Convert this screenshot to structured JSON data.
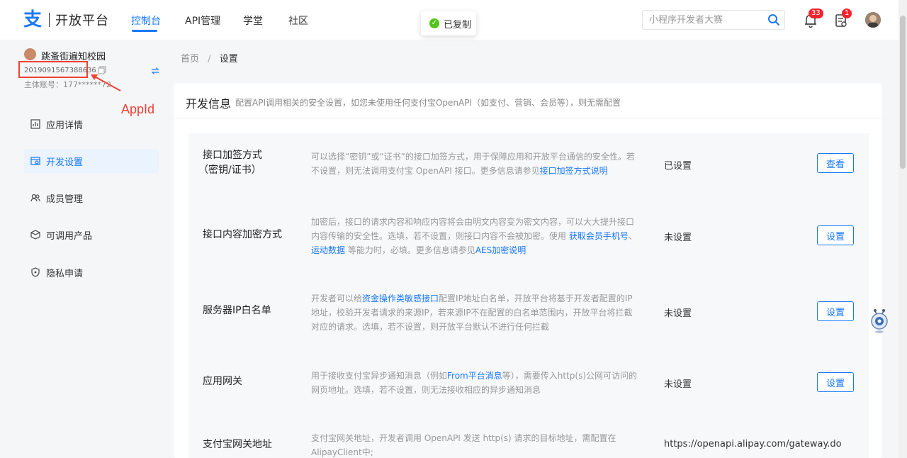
{
  "header": {
    "logo_mark": "支",
    "logo_text": "开放平台",
    "nav": [
      {
        "label": "控制台",
        "active": true
      },
      {
        "label": "API管理",
        "active": false
      },
      {
        "label": "学堂",
        "active": false
      },
      {
        "label": "社区",
        "active": false
      }
    ],
    "search_placeholder": "小程序开发者大赛",
    "notifications_badge": "33",
    "docs_badge": "1"
  },
  "toast": {
    "text": "已复制"
  },
  "sidebar": {
    "app_name": "跳蚤街遍知校园",
    "app_id": "2019091567388636",
    "owner_label": "主体账号：177******72",
    "annotation_label": "AppId",
    "menu": [
      {
        "label": "应用详情",
        "icon": "chart-icon",
        "active": false
      },
      {
        "label": "开发设置",
        "icon": "settings-icon",
        "active": true
      },
      {
        "label": "成员管理",
        "icon": "members-icon",
        "active": false
      },
      {
        "label": "可调用产品",
        "icon": "products-icon",
        "active": false
      },
      {
        "label": "隐私申请",
        "icon": "privacy-icon",
        "active": false
      }
    ]
  },
  "breadcrumb": {
    "home": "首页",
    "separator": "/",
    "current": "设置"
  },
  "card": {
    "title": "开发信息",
    "subtitle": "配置API调用相关的安全设置，如您未使用任何支付宝OpenAPI（如支付、营销、会员等），则无需配置"
  },
  "rows": [
    {
      "title_line1": "接口加签方式",
      "title_line2": "（密钥/证书）",
      "desc_pre": "可以选择“密钥”或“证书”的接口加签方式，用于保障应用和开放平台通信的安全性。若不设置，则无法调用支付宝 OpenAPI 接口。更多信息请参见",
      "desc_link": "接口加签方式说明",
      "status": "已设置",
      "button": "查看"
    },
    {
      "title_line1": "接口内容加密方式",
      "desc_pre": "加密后，接口的请求内容和响应内容将会由明文内容变为密文内容，可以大大提升接口内容传输的安全性。选填，若不设置，则接口内容不会被加密。使用 ",
      "desc_link1": "获取会员手机号",
      "desc_mid1": "、",
      "desc_link2": "运动数据",
      "desc_mid2": " 等能力时，必填。更多信息请参见",
      "desc_link3": "AES加密说明",
      "status": "未设置",
      "button": "设置"
    },
    {
      "title_line1": "服务器IP白名单",
      "desc_pre": "开发者可以给",
      "desc_link": "资金操作类敏感接口",
      "desc_post": "配置IP地址白名单，开放平台将基于开发者配置的IP地址，校验开发者请求的来源IP，若来源IP不在配置的白名单范围内，开放平台将拦截对应的请求。选填，若不设置，则开放平台默认不进行任何拦截",
      "status": "未设置",
      "button": "设置"
    },
    {
      "title_line1": "应用网关",
      "desc_pre": "用于接收支付宝异步通知消息（例如",
      "desc_link": "From平台消息",
      "desc_post": "等），需要传入http(s)公网可访问的网页地址。选填，若不设置，则无法接收相应的异步通知消息",
      "status": "未设置",
      "button": "设置"
    },
    {
      "title_line1": "支付宝网关地址",
      "desc_pre": "支付宝网关地址，开发者调用 OpenAPI 发送 http(s) 请求的目标地址，需配置在AlipayClient中;",
      "status": "https://openapi.alipay.com/gateway.do"
    }
  ]
}
